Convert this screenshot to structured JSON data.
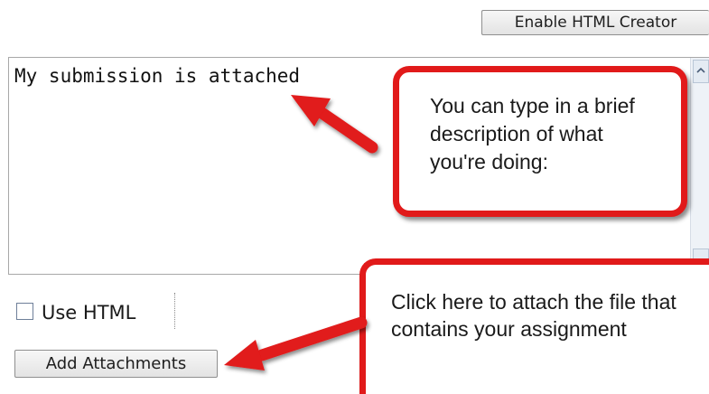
{
  "toolbar": {
    "enable_html_creator_label": "Enable HTML Creator"
  },
  "editor": {
    "text": "My submission is attached"
  },
  "options": {
    "use_html_label": "Use HTML",
    "use_html_checked": false
  },
  "attachments": {
    "add_attachments_label": "Add Attachments"
  },
  "callouts": {
    "description_hint": "You can type in a brief description of what you're doing:",
    "attach_hint": "Click here to attach the file that contains your assignment"
  },
  "colors": {
    "callout_border": "#e11a1a",
    "arrow": "#e11a1a"
  }
}
